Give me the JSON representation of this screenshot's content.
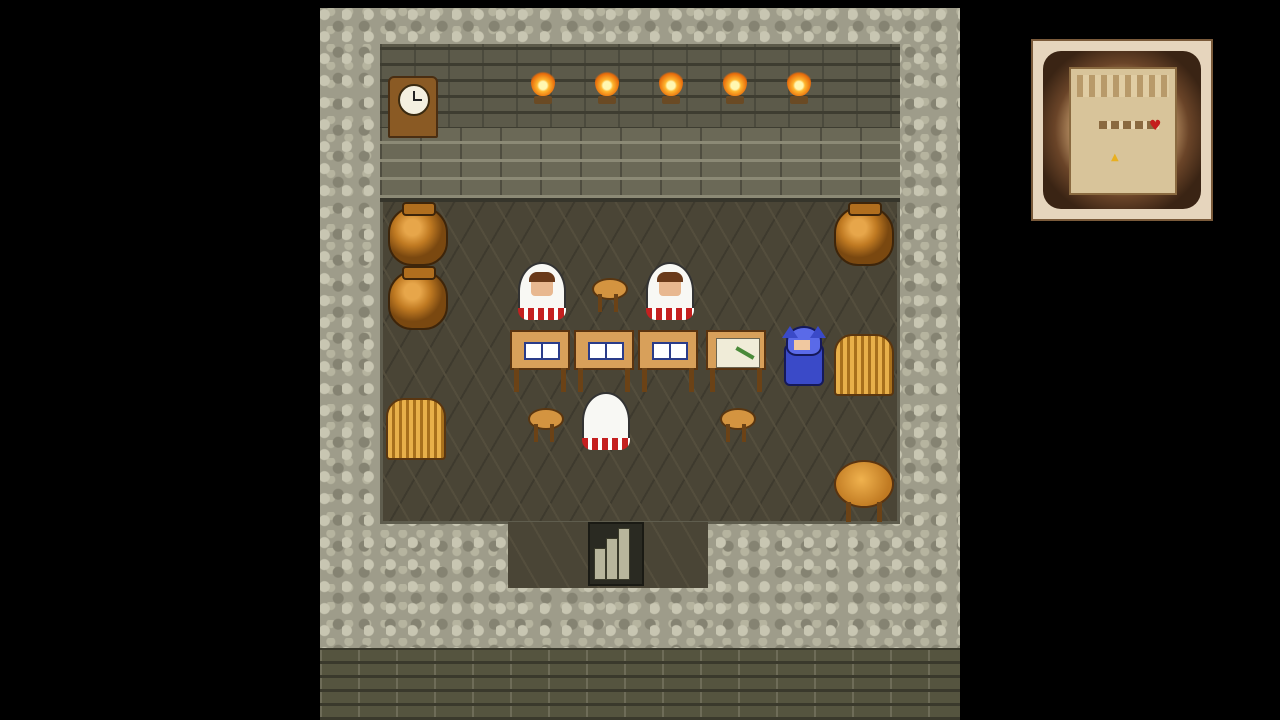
{
  "scene": {
    "location": "",
    "palette": {
      "floor": "#4a4536",
      "stone_wall": "#9e9c8a",
      "torch_flame": "#ffb52e",
      "robe_trim": "#c42020",
      "player": "#3a4ac8",
      "map_marker": "#c41e1e"
    }
  },
  "hud": {
    "minimap": {
      "player_marker_icon": "heart-marker-icon",
      "player_marker_glyph": "♥",
      "exit_marker_glyph": "▲"
    }
  },
  "npcs": [
    {
      "name": "",
      "type": "white-mage",
      "facing": "down"
    },
    {
      "name": "",
      "type": "white-mage",
      "facing": "down"
    },
    {
      "name": "",
      "type": "white-mage",
      "facing": "up"
    }
  ],
  "player": {
    "sprite": "blue-hooded-hero",
    "facing": "left"
  }
}
